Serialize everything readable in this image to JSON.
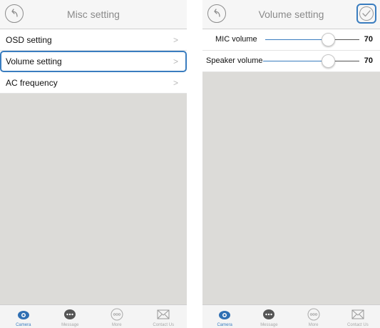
{
  "misc_screen": {
    "title": "Misc setting",
    "items": [
      {
        "label": "OSD setting",
        "chevron": ">"
      },
      {
        "label": "Volume setting",
        "chevron": ">"
      },
      {
        "label": "AC frequency",
        "chevron": ">"
      }
    ],
    "selected_index": 1
  },
  "volume_screen": {
    "title": "Volume setting",
    "mic": {
      "label": "MIC volume",
      "value": "70",
      "level_percent": 70
    },
    "speaker": {
      "label": "Speaker volume",
      "value": "70",
      "level_percent": 70
    }
  },
  "tabbar": {
    "tabs": [
      {
        "label": "Camera",
        "icon": "camera-icon",
        "active": true
      },
      {
        "label": "Message",
        "icon": "message-icon",
        "active": false
      },
      {
        "label": "More",
        "icon": "more-icon",
        "active": false
      },
      {
        "label": "Contact Us",
        "icon": "mail-icon",
        "active": false
      }
    ]
  },
  "colors": {
    "accent": "#3a7dbf",
    "background": "#dcdbd8",
    "header": "#f6f6f6"
  }
}
